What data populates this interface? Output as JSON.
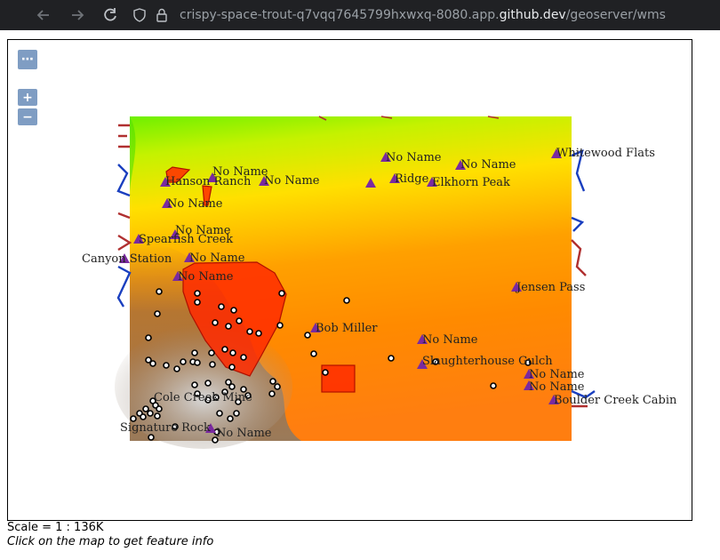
{
  "browser": {
    "url_prefix": "crispy-space-trout-q7vqq7645799hxwxq-8080.app.",
    "url_domain": "github.dev",
    "url_path": "/geoserver/wms"
  },
  "map": {
    "controls": {
      "menu": "⋯",
      "zoom_in": "+",
      "zoom_out": "−"
    },
    "colors": {
      "feature_fill": "#ff2a00",
      "marker": "#7a2aa0",
      "river": "#1a3fbf",
      "road": "#b03030"
    },
    "labels": [
      "Whitewood Flats",
      "No Name",
      "No Name",
      "Hanson Ranch",
      "No Name",
      "No Name",
      "Ridge",
      "Elkhorn Peak",
      "No Name",
      "No Name",
      "Spearfish Creek",
      "Canyon Station",
      "No Name",
      "No Name",
      "Jensen Pass",
      "Bob Miller",
      "No Name",
      "Slaughterhouse Gulch",
      "No Name",
      "No Name",
      "Boulder Creek Cabin",
      "Cole Creek Mine",
      "Signature Rock",
      "No Name"
    ]
  },
  "footer": {
    "scale": "Scale = 1 : 136K",
    "hint": "Click on the map to get feature info"
  }
}
